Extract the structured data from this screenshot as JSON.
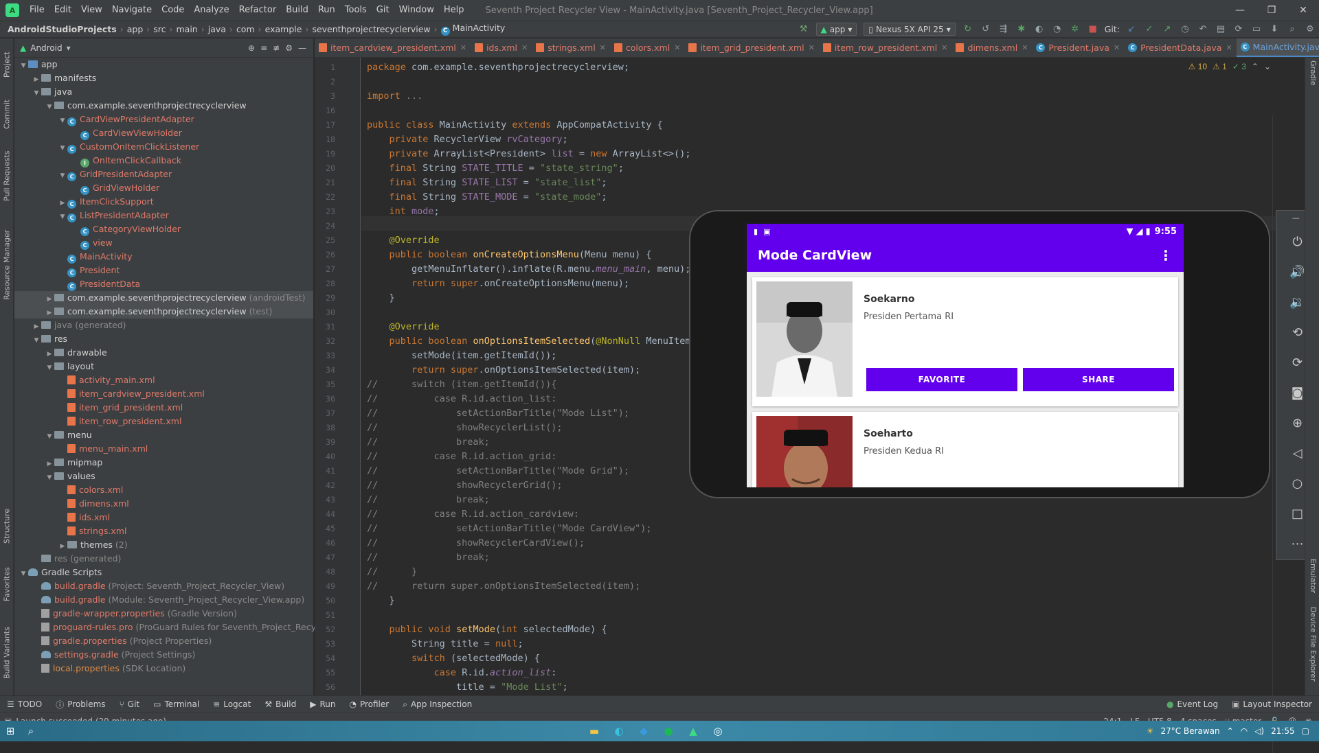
{
  "window": {
    "title": "Seventh Project Recycler View - MainActivity.java [Seventh_Project_Recycler_View.app]",
    "menu": [
      "File",
      "Edit",
      "View",
      "Navigate",
      "Code",
      "Analyze",
      "Refactor",
      "Build",
      "Run",
      "Tools",
      "Git",
      "Window",
      "Help"
    ]
  },
  "breadcrumb": [
    "AndroidStudioProjects",
    "app",
    "src",
    "main",
    "java",
    "com",
    "example",
    "seventhprojectrecyclerview",
    "MainActivity"
  ],
  "toolbar": {
    "run_config": "app",
    "device": "Nexus 5X API 25",
    "git_label": "Git:"
  },
  "project_panel": {
    "view_mode": "Android",
    "tree": [
      {
        "label": "app",
        "depth": 0,
        "kind": "folder-blue",
        "expanded": true,
        "color": ""
      },
      {
        "label": "manifests",
        "depth": 1,
        "kind": "folder",
        "expanded": false,
        "color": ""
      },
      {
        "label": "java",
        "depth": 1,
        "kind": "folder",
        "expanded": true,
        "color": ""
      },
      {
        "label": "com.example.seventhprojectrecyclerview",
        "depth": 2,
        "kind": "pkg",
        "expanded": true,
        "color": ""
      },
      {
        "label": "CardViewPresidentAdapter",
        "depth": 3,
        "kind": "class",
        "expanded": true,
        "color": "red"
      },
      {
        "label": "CardViewViewHolder",
        "depth": 4,
        "kind": "class",
        "color": "red"
      },
      {
        "label": "CustomOnItemClickListener",
        "depth": 3,
        "kind": "class",
        "expanded": true,
        "color": "red"
      },
      {
        "label": "OnItemClickCallback",
        "depth": 4,
        "kind": "iface",
        "color": "red"
      },
      {
        "label": "GridPresidentAdapter",
        "depth": 3,
        "kind": "class",
        "expanded": true,
        "color": "red"
      },
      {
        "label": "GridViewHolder",
        "depth": 4,
        "kind": "class",
        "color": "red"
      },
      {
        "label": "ItemClickSupport",
        "depth": 3,
        "kind": "class",
        "expanded": false,
        "color": "red"
      },
      {
        "label": "ListPresidentAdapter",
        "depth": 3,
        "kind": "class",
        "expanded": true,
        "color": "red"
      },
      {
        "label": "CategoryViewHolder",
        "depth": 4,
        "kind": "class",
        "color": "red"
      },
      {
        "label": "view",
        "depth": 4,
        "kind": "class",
        "color": "red"
      },
      {
        "label": "MainActivity",
        "depth": 3,
        "kind": "class",
        "color": "red"
      },
      {
        "label": "President",
        "depth": 3,
        "kind": "class",
        "color": "red"
      },
      {
        "label": "PresidentData",
        "depth": 3,
        "kind": "class",
        "color": "red"
      },
      {
        "label": "com.example.seventhprojectrecyclerview",
        "suffix": "(androidTest)",
        "depth": 2,
        "kind": "pkg",
        "expanded": false,
        "color": "",
        "sel": true
      },
      {
        "label": "com.example.seventhprojectrecyclerview",
        "suffix": "(test)",
        "depth": 2,
        "kind": "pkg",
        "expanded": false,
        "color": "",
        "sel": true
      },
      {
        "label": "java",
        "suffix": "(generated)",
        "depth": 1,
        "kind": "folder",
        "expanded": false,
        "color": "gray"
      },
      {
        "label": "res",
        "depth": 1,
        "kind": "folder",
        "expanded": true,
        "color": ""
      },
      {
        "label": "drawable",
        "depth": 2,
        "kind": "folder",
        "expanded": false,
        "color": ""
      },
      {
        "label": "layout",
        "depth": 2,
        "kind": "folder",
        "expanded": true,
        "color": ""
      },
      {
        "label": "activity_main.xml",
        "depth": 3,
        "kind": "xml",
        "color": "red"
      },
      {
        "label": "item_cardview_president.xml",
        "depth": 3,
        "kind": "xml",
        "color": "red"
      },
      {
        "label": "item_grid_president.xml",
        "depth": 3,
        "kind": "xml",
        "color": "red"
      },
      {
        "label": "item_row_president.xml",
        "depth": 3,
        "kind": "xml",
        "color": "red"
      },
      {
        "label": "menu",
        "depth": 2,
        "kind": "folder",
        "expanded": true,
        "color": ""
      },
      {
        "label": "menu_main.xml",
        "depth": 3,
        "kind": "xml",
        "color": "red"
      },
      {
        "label": "mipmap",
        "depth": 2,
        "kind": "folder",
        "expanded": false,
        "color": ""
      },
      {
        "label": "values",
        "depth": 2,
        "kind": "folder",
        "expanded": true,
        "color": ""
      },
      {
        "label": "colors.xml",
        "depth": 3,
        "kind": "xml",
        "color": "red"
      },
      {
        "label": "dimens.xml",
        "depth": 3,
        "kind": "xml",
        "color": "red"
      },
      {
        "label": "ids.xml",
        "depth": 3,
        "kind": "xml",
        "color": "red"
      },
      {
        "label": "strings.xml",
        "depth": 3,
        "kind": "xml",
        "color": "red"
      },
      {
        "label": "themes",
        "suffix": "(2)",
        "depth": 3,
        "kind": "folder",
        "expanded": false,
        "color": ""
      },
      {
        "label": "res",
        "suffix": "(generated)",
        "depth": 1,
        "kind": "folder",
        "color": "gray",
        "noarrow": true
      },
      {
        "label": "Gradle Scripts",
        "depth": 0,
        "kind": "gradle",
        "expanded": true,
        "color": ""
      },
      {
        "label": "build.gradle",
        "suffix": "(Project: Seventh_Project_Recycler_View)",
        "depth": 1,
        "kind": "gradle",
        "color": "red"
      },
      {
        "label": "build.gradle",
        "suffix": "(Module: Seventh_Project_Recycler_View.app)",
        "depth": 1,
        "kind": "gradle",
        "color": "red"
      },
      {
        "label": "gradle-wrapper.properties",
        "suffix": "(Gradle Version)",
        "depth": 1,
        "kind": "props",
        "color": "red"
      },
      {
        "label": "proguard-rules.pro",
        "suffix": "(ProGuard Rules for Seventh_Project_Recycler_View)",
        "depth": 1,
        "kind": "props",
        "color": "red"
      },
      {
        "label": "gradle.properties",
        "suffix": "(Project Properties)",
        "depth": 1,
        "kind": "props",
        "color": "red"
      },
      {
        "label": "settings.gradle",
        "suffix": "(Project Settings)",
        "depth": 1,
        "kind": "gradle",
        "color": "red"
      },
      {
        "label": "local.properties",
        "suffix": "(SDK Location)",
        "depth": 1,
        "kind": "props",
        "color": "orange"
      }
    ]
  },
  "left_strip_tabs": [
    "Project",
    "Commit",
    "Pull Requests",
    "Resource Manager",
    "Structure",
    "Favorites",
    "Build Variants"
  ],
  "editor_tabs": [
    {
      "label": "item_cardview_president.xml",
      "kind": "xml",
      "active": false
    },
    {
      "label": "ids.xml",
      "kind": "xml",
      "active": false
    },
    {
      "label": "strings.xml",
      "kind": "xml",
      "active": false
    },
    {
      "label": "colors.xml",
      "kind": "xml",
      "active": false
    },
    {
      "label": "item_grid_president.xml",
      "kind": "xml",
      "active": false
    },
    {
      "label": "item_row_president.xml",
      "kind": "xml",
      "active": false
    },
    {
      "label": "dimens.xml",
      "kind": "xml",
      "active": false
    },
    {
      "label": "President.java",
      "kind": "class",
      "active": false
    },
    {
      "label": "PresidentData.java",
      "kind": "class",
      "active": false
    },
    {
      "label": "MainActivity.java",
      "kind": "class",
      "active": true
    }
  ],
  "inspections": {
    "warnings": "10",
    "weak": "1",
    "ok": "3"
  },
  "code": {
    "line_numbers": [
      "1",
      "2",
      "3",
      "16",
      "17",
      "18",
      "19",
      "20",
      "21",
      "22",
      "23",
      "24",
      "25",
      "26",
      "27",
      "28",
      "29",
      "30",
      "31",
      "32",
      "33",
      "34",
      "35",
      "36",
      "37",
      "38",
      "39",
      "40",
      "41",
      "42",
      "43",
      "44",
      "45",
      "46",
      "47",
      "48",
      "49",
      "50",
      "51",
      "52",
      "53",
      "54",
      "55",
      "56"
    ],
    "lines": [
      [
        [
          "kw",
          "package "
        ],
        [
          "",
          "com.example.seventhprojectrecyclerview;"
        ]
      ],
      [],
      [
        [
          "kw",
          "import "
        ],
        [
          "cmt",
          "..."
        ]
      ],
      [],
      [
        [
          "kw",
          "public class "
        ],
        [
          "",
          "MainActivity "
        ],
        [
          "kw",
          "extends "
        ],
        [
          "",
          "AppCompatActivity {"
        ]
      ],
      [
        [
          "",
          "    "
        ],
        [
          "kw",
          "private "
        ],
        [
          "",
          "RecyclerView "
        ],
        [
          "fld",
          "rvCategory"
        ],
        [
          "",
          ";"
        ]
      ],
      [
        [
          "",
          "    "
        ],
        [
          "kw",
          "private "
        ],
        [
          "",
          "ArrayList<President> "
        ],
        [
          "fld",
          "list "
        ],
        [
          "",
          "= "
        ],
        [
          "kw",
          "new "
        ],
        [
          "",
          "ArrayList<>();"
        ]
      ],
      [
        [
          "",
          "    "
        ],
        [
          "kw",
          "final "
        ],
        [
          "",
          "String "
        ],
        [
          "fld",
          "STATE_TITLE "
        ],
        [
          "",
          "= "
        ],
        [
          "str",
          "\"state_string\""
        ],
        [
          "",
          ";"
        ]
      ],
      [
        [
          "",
          "    "
        ],
        [
          "kw",
          "final "
        ],
        [
          "",
          "String "
        ],
        [
          "fld",
          "STATE_LIST "
        ],
        [
          "",
          "= "
        ],
        [
          "str",
          "\"state_list\""
        ],
        [
          "",
          ";"
        ]
      ],
      [
        [
          "",
          "    "
        ],
        [
          "kw",
          "final "
        ],
        [
          "",
          "String "
        ],
        [
          "fld",
          "STATE_MODE "
        ],
        [
          "",
          "= "
        ],
        [
          "str",
          "\"state_mode\""
        ],
        [
          "",
          ";"
        ]
      ],
      [
        [
          "",
          "    "
        ],
        [
          "kw",
          "int "
        ],
        [
          "fld",
          "mode"
        ],
        [
          "",
          ";"
        ]
      ],
      [],
      [
        [
          "",
          "    "
        ],
        [
          "ann",
          "@Override"
        ]
      ],
      [
        [
          "",
          "    "
        ],
        [
          "kw",
          "public boolean "
        ],
        [
          "fn",
          "onCreateOptionsMenu"
        ],
        [
          "",
          "(Menu menu) {"
        ]
      ],
      [
        [
          "",
          "        getMenuInflater().inflate(R.menu."
        ],
        [
          "fld it",
          "menu_main"
        ],
        [
          "",
          ", menu);"
        ]
      ],
      [
        [
          "",
          "        "
        ],
        [
          "kw",
          "return super"
        ],
        [
          "",
          ".onCreateOptionsMenu(menu);"
        ]
      ],
      [
        [
          "",
          "    }"
        ]
      ],
      [],
      [
        [
          "",
          "    "
        ],
        [
          "ann",
          "@Override"
        ]
      ],
      [
        [
          "",
          "    "
        ],
        [
          "kw",
          "public boolean "
        ],
        [
          "fn",
          "onOptionsItemSelected"
        ],
        [
          "",
          "("
        ],
        [
          "ann",
          "@NonNull "
        ],
        [
          "",
          "MenuItem item) {"
        ]
      ],
      [
        [
          "",
          "        setMode(item.getItemId());"
        ]
      ],
      [
        [
          "",
          "        "
        ],
        [
          "kw",
          "return super"
        ],
        [
          "",
          ".onOptionsItemSelected(item);"
        ]
      ],
      [
        [
          "cmt",
          "//      switch (item.getItemId()){"
        ]
      ],
      [
        [
          "cmt",
          "//          case R.id.action_list:"
        ]
      ],
      [
        [
          "cmt",
          "//              setActionBarTitle(\"Mode List\");"
        ]
      ],
      [
        [
          "cmt",
          "//              showRecyclerList();"
        ]
      ],
      [
        [
          "cmt",
          "//              break;"
        ]
      ],
      [
        [
          "cmt",
          "//          case R.id.action_grid:"
        ]
      ],
      [
        [
          "cmt",
          "//              setActionBarTitle(\"Mode Grid\");"
        ]
      ],
      [
        [
          "cmt",
          "//              showRecyclerGrid();"
        ]
      ],
      [
        [
          "cmt",
          "//              break;"
        ]
      ],
      [
        [
          "cmt",
          "//          case R.id.action_cardview:"
        ]
      ],
      [
        [
          "cmt",
          "//              setActionBarTitle(\"Mode CardView\");"
        ]
      ],
      [
        [
          "cmt",
          "//              showRecyclerCardView();"
        ]
      ],
      [
        [
          "cmt",
          "//              break;"
        ]
      ],
      [
        [
          "cmt",
          "//      }"
        ]
      ],
      [
        [
          "cmt",
          "//      return super.onOptionsItemSelected(item);"
        ]
      ],
      [
        [
          "",
          "    }"
        ]
      ],
      [],
      [
        [
          "",
          "    "
        ],
        [
          "kw",
          "public void "
        ],
        [
          "fn",
          "setMode"
        ],
        [
          "",
          "("
        ],
        [
          "kw",
          "int "
        ],
        [
          "",
          "selectedMode) {"
        ]
      ],
      [
        [
          "",
          "        String title = "
        ],
        [
          "kw",
          "null"
        ],
        [
          "",
          ";"
        ]
      ],
      [
        [
          "",
          "        "
        ],
        [
          "kw",
          "switch "
        ],
        [
          "",
          "(selectedMode) {"
        ]
      ],
      [
        [
          "",
          "            "
        ],
        [
          "kw",
          "case "
        ],
        [
          "",
          "R.id."
        ],
        [
          "fld it",
          "action_list"
        ],
        [
          "",
          ":"
        ]
      ],
      [
        [
          "",
          "                title = "
        ],
        [
          "str",
          "\"Mode List\""
        ],
        [
          "",
          ";"
        ]
      ]
    ]
  },
  "emulator": {
    "status_time": "9:55",
    "app_title": "Mode CardView",
    "cards": [
      {
        "name": "Soekarno",
        "desc": "Presiden Pertama RI",
        "favorite": "FAVORITE",
        "share": "SHARE"
      },
      {
        "name": "Soeharto",
        "desc": "Presiden Kedua RI"
      }
    ]
  },
  "right_strip_tabs": [
    "Gradle",
    "Emulator",
    "Device File Explorer"
  ],
  "bottom_tabs": [
    "TODO",
    "Problems",
    "Git",
    "Terminal",
    "Logcat",
    "Build",
    "Run",
    "Profiler",
    "App Inspection"
  ],
  "bottom_right_tabs": [
    "Event Log",
    "Layout Inspector"
  ],
  "status": {
    "message": "Launch succeeded (29 minutes ago)",
    "position": "24:1",
    "line_sep": "LF",
    "encoding": "UTF-8",
    "indent": "4 spaces",
    "branch": "master"
  },
  "taskbar": {
    "weather": "27°C  Berawan",
    "clock": "21:55"
  },
  "colors": {
    "purple": "#6200ee",
    "ide_bg": "#2b2b2b",
    "panel_bg": "#3c3f41"
  }
}
